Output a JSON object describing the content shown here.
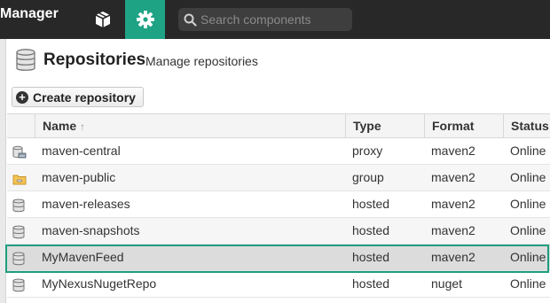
{
  "header": {
    "app_title": "Manager",
    "browse_icon": "cube-icon",
    "admin_icon": "gear-icon",
    "search_icon": "search-icon",
    "search_placeholder": "Search components",
    "accent_color": "#1fa385"
  },
  "page": {
    "icon": "database-icon",
    "title": "Repositories",
    "subtitle": "Manage repositories",
    "create_button_label": "Create repository"
  },
  "table": {
    "columns": [
      {
        "label": "Name",
        "sort_icon": "sort-up-arrow-icon"
      },
      {
        "label": "Type"
      },
      {
        "label": "Format"
      },
      {
        "label": "Status"
      }
    ],
    "rows": [
      {
        "icon": "proxy-repo-icon",
        "name": "maven-central",
        "type": "proxy",
        "format": "maven2",
        "status": "Online"
      },
      {
        "icon": "group-repo-icon",
        "name": "maven-public",
        "type": "group",
        "format": "maven2",
        "status": "Online"
      },
      {
        "icon": "hosted-repo-icon",
        "name": "maven-releases",
        "type": "hosted",
        "format": "maven2",
        "status": "Online"
      },
      {
        "icon": "hosted-repo-icon",
        "name": "maven-snapshots",
        "type": "hosted",
        "format": "maven2",
        "status": "Online"
      },
      {
        "icon": "hosted-repo-icon",
        "name": "MyMavenFeed",
        "type": "hosted",
        "format": "maven2",
        "status": "Online",
        "selected": true
      },
      {
        "icon": "hosted-repo-icon",
        "name": "MyNexusNugetRepo",
        "type": "hosted",
        "format": "nuget",
        "status": "Online"
      }
    ],
    "selection_color": "#1e9e7e"
  }
}
